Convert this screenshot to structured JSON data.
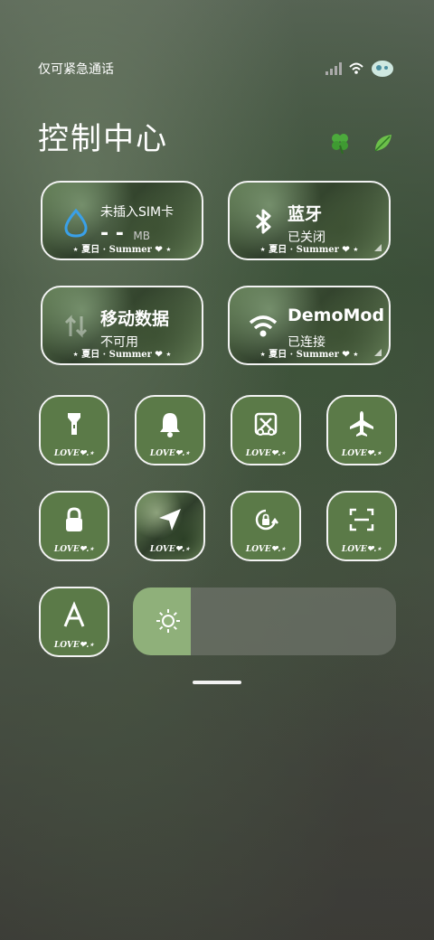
{
  "status_bar": {
    "text": "仅可紧急通话"
  },
  "header": {
    "title": "控制中心",
    "icons": [
      "clover-icon",
      "leaf-icon"
    ]
  },
  "cards": {
    "data_usage": {
      "label": "未插入SIM卡",
      "value": "- -",
      "unit": "MB",
      "deco": "⋆ 夏日 · Summer ❤ ⋆"
    },
    "bluetooth": {
      "label": "蓝牙",
      "sub": "已关闭",
      "deco": "⋆ 夏日 · Summer ❤ ⋆"
    },
    "mobile_data": {
      "label": "移动数据",
      "sub": "不可用",
      "deco": "⋆ 夏日 · Summer ❤ ⋆"
    },
    "wifi": {
      "label": "DemoMod",
      "sub": "已连接",
      "deco": "⋆ 夏日 · Summer ❤ ⋆"
    }
  },
  "tiles": [
    {
      "icon": "flashlight-icon",
      "label": "LOVE❤.⋆"
    },
    {
      "icon": "bell-icon",
      "label": "LOVE❤.⋆"
    },
    {
      "icon": "screenshot-scissors-icon",
      "label": "LOVE❤.⋆"
    },
    {
      "icon": "airplane-icon",
      "label": "LOVE❤.⋆"
    },
    {
      "icon": "lock-icon",
      "label": "LOVE❤.⋆"
    },
    {
      "icon": "location-arrow-icon",
      "label": "LOVE❤.⋆"
    },
    {
      "icon": "rotation-lock-icon",
      "label": "LOVE❤.⋆"
    },
    {
      "icon": "scan-icon",
      "label": "LOVE❤.⋆"
    },
    {
      "icon": "font-a-icon",
      "label": "LOVE❤.⋆"
    }
  ],
  "brightness": {
    "level": 0.22,
    "icon": "sun-icon"
  },
  "colors": {
    "tile_green": "#5b7a48",
    "slider_fill": "#8fb07a",
    "accent_blue": "#3aa0e8"
  }
}
